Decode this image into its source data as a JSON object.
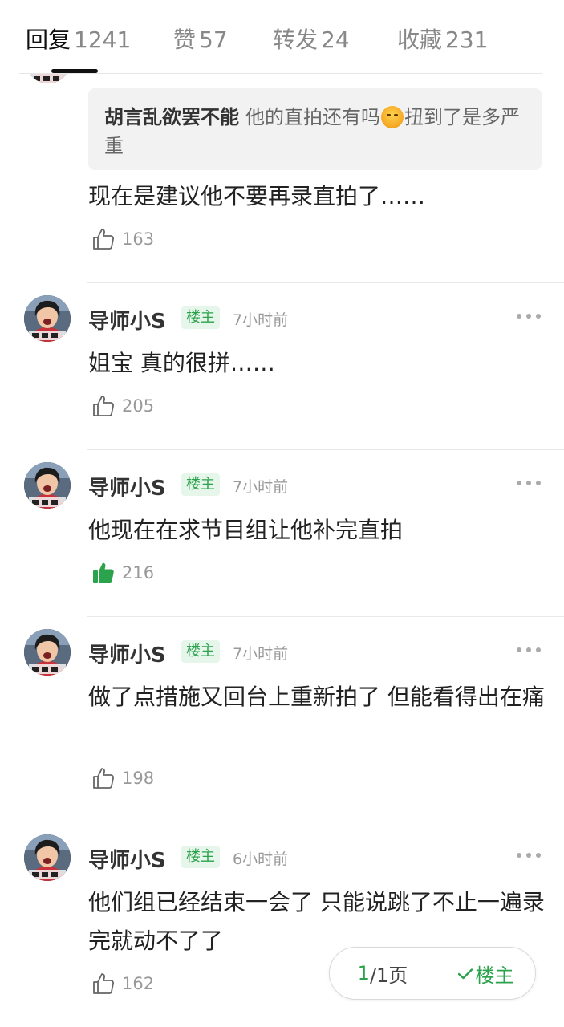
{
  "tabs": [
    {
      "name": "回复",
      "count": "1241"
    },
    {
      "name": "赞",
      "count": "57"
    },
    {
      "name": "转发",
      "count": "24"
    },
    {
      "name": "收藏",
      "count": "231"
    }
  ],
  "first_reply": {
    "quote_author": "胡言乱欲罢不能",
    "quote_text_before": "他的直拍还有吗",
    "quote_emoji": "cry-face-icon",
    "quote_text_after": "扭到了是多严重",
    "text": "现在是建议他不要再录直拍了……",
    "likes": "163"
  },
  "comments": [
    {
      "author": "导师小S",
      "badge": "楼主",
      "time": "7小时前",
      "text": "姐宝 真的很拼……",
      "likes": "205",
      "liked": false
    },
    {
      "author": "导师小S",
      "badge": "楼主",
      "time": "7小时前",
      "text": "他现在在求节目组让他补完直拍",
      "likes": "216",
      "liked": true
    },
    {
      "author": "导师小S",
      "badge": "楼主",
      "time": "7小时前",
      "text": "做了点措施又回台上重新拍了 但能看得出在痛",
      "likes": "198",
      "liked": false
    },
    {
      "author": "导师小S",
      "badge": "楼主",
      "time": "6小时前",
      "text": "他们组已经结束一会了 只能说跳了不止一遍录完就动不了了",
      "likes": "162",
      "liked": false
    }
  ],
  "pager": {
    "current": "1",
    "total_text": "/1页",
    "op_filter_label": "楼主"
  },
  "colors": {
    "accent_green": "#2ba24c",
    "badge_bg": "#e6f6ea"
  }
}
